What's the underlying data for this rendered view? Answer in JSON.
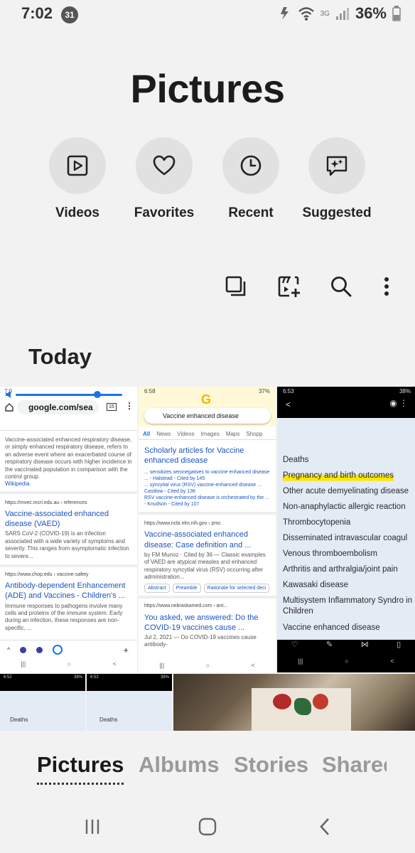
{
  "status": {
    "time": "7:02",
    "notification_count": "31",
    "network": "3G",
    "battery": "36%"
  },
  "title": "Pictures",
  "quick": [
    {
      "label": "Videos",
      "icon": "play-box-icon"
    },
    {
      "label": "Favorites",
      "icon": "heart-icon"
    },
    {
      "label": "Recent",
      "icon": "clock-icon"
    },
    {
      "label": "Suggested",
      "icon": "sparkle-chat-icon"
    }
  ],
  "section_title": "Today",
  "thumbs": {
    "t1": {
      "time": "7:0",
      "url": "google.com/sea",
      "tab_count": "15",
      "snippet": "Vaccine-associated enhanced respiratory disease, or simply enhanced respiratory disease, refers to an adverse event where an exacerbated course of respiratory disease occurs with higher incidence in the vaccinated population in comparison with the control group.",
      "snippet_link": "Wikipedia",
      "r1_source": "https://mvec.mcri.edu.au › references",
      "r1_title": "Vaccine-associated enhanced disease (VAED)",
      "r1_desc": "SARS CoV-2 (COVID-19) is an infection associated with a wide variety of symptoms and severity. This ranges from asymptomatic infection to severe...",
      "r2_source": "https://www.chop.edu › vaccine-safety",
      "r2_title": "Antibody-dependent Enhancement (ADE) and Vaccines - Children's ...",
      "r2_desc": "Immune responses to pathogens involve many cells and proteins of the immune system. Early during an infection, these responses are non-specific, ..."
    },
    "t2": {
      "time": "6:58",
      "battery": "37%",
      "query": "Vaccine enhanced disease",
      "tabs": [
        "All",
        "News",
        "Videos",
        "Images",
        "Maps",
        "Shopp"
      ],
      "scholar_title": "Scholarly articles for Vaccine enhanced disease",
      "scholar_lines": [
        "... sensitizes seronegatives to vaccine enhanced disease ... - Halstead - Cited by 145",
        "... syncytial virus (RSV) vaccine-enhanced disease ... Castilow - Cited by 136",
        "RSV vaccine-enhanced disease is orchestrated by the ... - Knudson - Cited by 107"
      ],
      "r1_source": "https://www.ncbi.nlm.nih.gov › pmc",
      "r1_title": "Vaccine-associated enhanced disease: Case definition and ...",
      "r1_desc": "by FM Munoz · Cited by 36 — Classic examples of VAED are atypical measles and enhanced respiratory syncytial virus (RSV) occurring after administration...",
      "chips": [
        "Abstract",
        "Preamble",
        "Rationale for selected deci"
      ],
      "r2_source": "https://www.nebraskamed.com › ant...",
      "r2_title": "You asked, we answered: Do the COVID-19 vaccines cause ...",
      "r2_desc": "Jul 2, 2021 — Do COVID-19 vaccines cause antibody-"
    },
    "t3": {
      "time": "6:53",
      "battery": "38%",
      "lines": [
        "Deaths",
        "Pregnancy and birth outcomes",
        "Other acute demyelinating disease",
        "Non-anaphylactic allergic reaction",
        "Thrombocytopenia",
        "Disseminated intravascular coagul",
        "Venous thromboembolism",
        "Arthritis and arthralgia/joint pain",
        "Kawasaki disease",
        "Multisystem Inflammatory Syndro in Children",
        "Vaccine enhanced disease"
      ]
    },
    "t4": {
      "time": "6:52",
      "battery": "38%",
      "line": "Deaths"
    },
    "t5": {
      "time": "6:52",
      "battery": "38%",
      "line": "Deaths"
    }
  },
  "tabs": [
    {
      "label": "Pictures",
      "active": true
    },
    {
      "label": "Albums",
      "active": false
    },
    {
      "label": "Stories",
      "active": false
    },
    {
      "label": "Shared",
      "active": false
    }
  ],
  "colors": {
    "background": "#f2f2f2",
    "highlight": "#ffe600",
    "link": "#1a55c0"
  }
}
